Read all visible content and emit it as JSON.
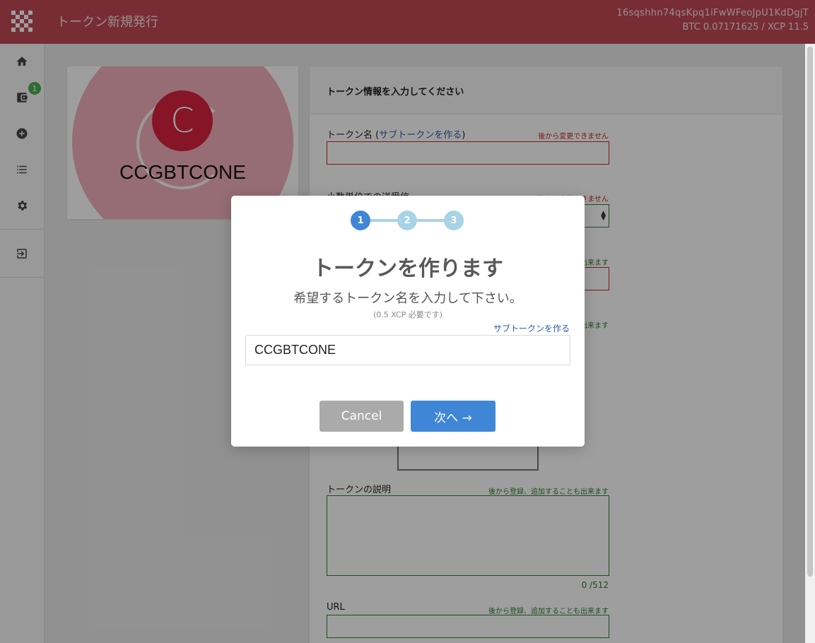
{
  "header": {
    "title": "トークン新規発行",
    "address": "16sqshhn74qsKpq1iFwWFeoJpU1KdDgjT",
    "balance": "BTC 0.07171625 / XCP 11.5"
  },
  "sidebar": {
    "items": [
      {
        "icon": "home-icon"
      },
      {
        "icon": "wallet-icon",
        "badge": "1"
      },
      {
        "icon": "add-circle-icon"
      },
      {
        "icon": "list-icon"
      },
      {
        "icon": "gear-icon"
      },
      {
        "icon": "logout-icon"
      }
    ]
  },
  "preview": {
    "icon_letter": "C",
    "token_name": "CCGBTCONE"
  },
  "form": {
    "heading": "トークン情報を入力してください",
    "token_name_label": "トークン名 (",
    "subtoken_link": "サブトークンを作る",
    "token_name_label_end": ")",
    "token_name_note": "後から変更できません",
    "decimal_label": "小数単位での送受信",
    "decimal_note": "後から変更できません",
    "field3_note": "出来ます",
    "field4_note": "出来ます",
    "description_label": "トークンの説明",
    "description_note": "後から登録、追加することも出来ます",
    "description_counter": "0 /512",
    "url_label": "URL",
    "url_note": "後から登録、追加することも出来ます"
  },
  "modal": {
    "steps": [
      "1",
      "2",
      "3"
    ],
    "active_step": 1,
    "title": "トークンを作ります",
    "subtitle": "希望するトークン名を入力して下さい。",
    "fee_note": "(0.5 XCP 必要です)",
    "subtoken_link": "サブトークンを作る",
    "input_value": "CCGBTCONE",
    "cancel_label": "Cancel",
    "next_label": "次へ →"
  },
  "colors": {
    "header": "#c24a54",
    "accent": "#3f87d6",
    "step_inactive": "#a8d3e6",
    "token_icon": "#d9223f",
    "error": "#c62828",
    "ok": "#2e7d32"
  }
}
